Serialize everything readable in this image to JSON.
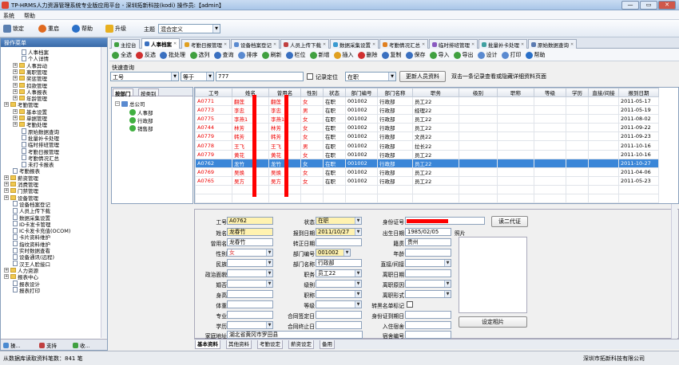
{
  "window": {
    "title": "TP-HRMS人力资源管理系统专业版应用平台 - 深圳拓新科技(kodi)   操作员:【admin】",
    "controls": [
      "—",
      "▭",
      "✕"
    ]
  },
  "menu": [
    "系统",
    "帮助"
  ],
  "toolbar": {
    "lock": "锁定",
    "restart": "重启",
    "help": "帮助",
    "upgrade": "升级",
    "theme_label": "主题",
    "theme_value": "混合定义"
  },
  "sidebar": {
    "header": "操作菜单",
    "items": [
      {
        "label": "人事档案",
        "level": 2,
        "kind": "page"
      },
      {
        "label": "个人详情",
        "level": 2,
        "kind": "page"
      },
      {
        "label": "人事异动",
        "level": 1,
        "kind": "folder"
      },
      {
        "label": "离职管理",
        "level": 1,
        "kind": "folder"
      },
      {
        "label": "奖惩管理",
        "level": 1,
        "kind": "folder"
      },
      {
        "label": "扣款管理",
        "level": 1,
        "kind": "folder"
      },
      {
        "label": "人事报表",
        "level": 1,
        "kind": "folder"
      },
      {
        "label": "年龄管理",
        "level": 1,
        "kind": "folder"
      },
      {
        "label": "考勤管理",
        "level": 0,
        "kind": "folder"
      },
      {
        "label": "基本设置",
        "level": 1,
        "kind": "folder"
      },
      {
        "label": "单据管理",
        "level": 1,
        "kind": "folder"
      },
      {
        "label": "考勤处理",
        "level": 1,
        "kind": "folder"
      },
      {
        "label": "原始数据查询",
        "level": 2,
        "kind": "page"
      },
      {
        "label": "批量补卡处理",
        "level": 2,
        "kind": "page"
      },
      {
        "label": "临时排班管理",
        "level": 2,
        "kind": "page"
      },
      {
        "label": "考勤日报管理",
        "level": 2,
        "kind": "page"
      },
      {
        "label": "考勤情况汇总",
        "level": 2,
        "kind": "page"
      },
      {
        "label": "未打卡报表",
        "level": 2,
        "kind": "page"
      },
      {
        "label": "考勤报表",
        "level": 1,
        "kind": "page"
      },
      {
        "label": "薪资管理",
        "level": 0,
        "kind": "folder"
      },
      {
        "label": "消费管理",
        "level": 0,
        "kind": "folder"
      },
      {
        "label": "门禁管理",
        "level": 0,
        "kind": "folder"
      },
      {
        "label": "设备管理",
        "level": 0,
        "kind": "folder"
      },
      {
        "label": "设备档案登记",
        "level": 1,
        "kind": "page"
      },
      {
        "label": "人员上传下载",
        "level": 1,
        "kind": "page"
      },
      {
        "label": "数据采集设置",
        "level": 1,
        "kind": "page"
      },
      {
        "label": "ID卡发卡管理",
        "level": 1,
        "kind": "page"
      },
      {
        "label": "IC卡发卡充值(OCOM)",
        "level": 1,
        "kind": "page"
      },
      {
        "label": "卡片资料维护",
        "level": 1,
        "kind": "page"
      },
      {
        "label": "指纹资料维护",
        "level": 1,
        "kind": "page"
      },
      {
        "label": "实时数据查看",
        "level": 1,
        "kind": "page"
      },
      {
        "label": "设备通讯(远程)",
        "level": 1,
        "kind": "page"
      },
      {
        "label": "汉王人脸接口",
        "level": 1,
        "kind": "page"
      },
      {
        "label": "人力资源",
        "level": 0,
        "kind": "folder"
      },
      {
        "label": "报表中心",
        "level": 0,
        "kind": "folder"
      },
      {
        "label": "报表设计",
        "level": 1,
        "kind": "page"
      },
      {
        "label": "报表打印",
        "level": 1,
        "kind": "page"
      }
    ],
    "bottom_tabs": [
      "操...",
      "支持",
      "收..."
    ]
  },
  "tabs": [
    "主控台",
    "人事档案",
    "考勤日报管理",
    "设备档案登记",
    "人员上传下载",
    "数据采集设置",
    "考勤情况汇总",
    "临时排班管理",
    "批量补卡处理",
    "原始数据查询"
  ],
  "subtoolbar": [
    "全选",
    "反选",
    "批处理",
    "选列",
    "查询",
    "排序",
    "刷新",
    "栏位",
    "新增",
    "插入",
    "删除",
    "复制",
    "保存",
    "导入",
    "导出",
    "设计",
    "打印",
    "帮助"
  ],
  "quicksearch": {
    "label": "快速查询",
    "field": "工号",
    "op": "等于",
    "value": "777",
    "record_pos": "记录定位",
    "status": "在职",
    "refresh_btn": "更新人员资料",
    "hint": "双击一条记录查看或隐藏详细资料页面"
  },
  "group": {
    "tab1": "按部门",
    "tab2": "按类别",
    "root": "总公司",
    "children": [
      "人事部",
      "行政部",
      "销售部"
    ]
  },
  "grid": {
    "headers": [
      "工号",
      "姓名",
      "曾用名",
      "性别",
      "状态",
      "部门编号",
      "部门名称",
      "职务",
      "级别",
      "职称",
      "等级",
      "学历",
      "直接/间接",
      "报到日期"
    ],
    "rows": [
      [
        "A0771",
        "翻莲",
        "翻莲",
        "女",
        "在职",
        "001002",
        "行政部",
        "员工22",
        "",
        "",
        "",
        "",
        "",
        "2011-05-17"
      ],
      [
        "A0773",
        "李忠",
        "李忠",
        "男",
        "在职",
        "001002",
        "行政部",
        "经理22",
        "",
        "",
        "",
        "",
        "",
        "2011-05-19"
      ],
      [
        "A0775",
        "李燕1",
        "李燕1",
        "女",
        "在职",
        "001002",
        "行政部",
        "员工22",
        "",
        "",
        "",
        "",
        "",
        "2011-08-02"
      ],
      [
        "A0744",
        "林芳",
        "林芳",
        "女",
        "在职",
        "001002",
        "行政部",
        "员工22",
        "",
        "",
        "",
        "",
        "",
        "2011-09-22"
      ],
      [
        "A0779",
        "韩芳",
        "韩芳",
        "女",
        "在职",
        "001002",
        "行政部",
        "文员22",
        "",
        "",
        "",
        "",
        "",
        "2011-09-23"
      ],
      [
        "A0778",
        "王飞",
        "王飞",
        "男",
        "在职",
        "001002",
        "行政部",
        "拉长22",
        "",
        "",
        "",
        "",
        "",
        "2011-10-16"
      ],
      [
        "A0779",
        "黄花",
        "黄花",
        "女",
        "在职",
        "001002",
        "行政部",
        "员工22",
        "",
        "",
        "",
        "",
        "",
        "2011-10-16"
      ],
      [
        "A0762",
        "龙竹",
        "龙竹",
        "女",
        "在职",
        "001002",
        "行政部",
        "员工22",
        "",
        "",
        "",
        "",
        "",
        "2011-10-27"
      ],
      [
        "A0769",
        "吴焕",
        "吴焕",
        "女",
        "在职",
        "001002",
        "行政部",
        "员工22",
        "",
        "",
        "",
        "",
        "",
        "2011-04-06"
      ],
      [
        "A0765",
        "吴方",
        "吴方",
        "女",
        "在职",
        "001002",
        "行政部",
        "员工22",
        "",
        "",
        "",
        "",
        "",
        "2011-05-23"
      ]
    ],
    "selected_row": 7
  },
  "detail": {
    "emp_no": {
      "label": "工号",
      "value": "A0762"
    },
    "name": {
      "label": "姓名",
      "value": "龙春竹"
    },
    "former": {
      "label": "曾用名",
      "value": "龙春竹"
    },
    "gender": {
      "label": "性别",
      "value": "女"
    },
    "ethnic": {
      "label": "民族"
    },
    "politics": {
      "label": "政治面貌"
    },
    "marriage": {
      "label": "婚否"
    },
    "height": {
      "label": "身高"
    },
    "weight": {
      "label": "体重"
    },
    "major": {
      "label": "专业"
    },
    "education": {
      "label": "学历"
    },
    "address": {
      "label": "家庭地址",
      "value": "湖北省黄冈市罗田县"
    },
    "status": {
      "label": "状态",
      "value": "在职"
    },
    "report_date": {
      "label": "报到日期",
      "value": "2011/10/27"
    },
    "regular_date": {
      "label": "转正日期"
    },
    "dept_no": {
      "label": "部门编号",
      "value": "001002"
    },
    "dept_name": {
      "label": "部门名称",
      "value": "行政部"
    },
    "position": {
      "label": "职务",
      "value": "员工22"
    },
    "level": {
      "label": "级别"
    },
    "title": {
      "label": "职称"
    },
    "grade": {
      "label": "等级"
    },
    "contract_sign": {
      "label": "合同签定日"
    },
    "contract_end": {
      "label": "合同终止日"
    },
    "id_no": {
      "label": "身份证号"
    },
    "birth": {
      "label": "出生日期",
      "value": "1985/02/05"
    },
    "native": {
      "label": "籍贯",
      "value": "贵州"
    },
    "age": {
      "label": "年龄"
    },
    "direct": {
      "label": "直接/间接"
    },
    "leave_date": {
      "label": "离职日期"
    },
    "leave_reason": {
      "label": "离职原因"
    },
    "leave_type": {
      "label": "离职形式"
    },
    "blacklist": {
      "label": "转黑名单标记"
    },
    "id_expire": {
      "label": "身份证到期日"
    },
    "join_dorm": {
      "label": "入住宿舍"
    },
    "dorm_no": {
      "label": "宿舍编号"
    },
    "photo": {
      "label": "照片"
    },
    "read_id_btn": "读二代证",
    "set_photo_btn": "设定相片"
  },
  "bottom_tabs": [
    "基本资料",
    "其他资料",
    "考勤设定",
    "薪资设定",
    "备用"
  ],
  "status": {
    "left": "从数据库读取资料笔数：841 笔",
    "right": "深圳市拓新科技有限公司"
  },
  "colors": {
    "accent": "#3a86d8",
    "red": "#ff0000",
    "highlight": "#fff2b0"
  }
}
